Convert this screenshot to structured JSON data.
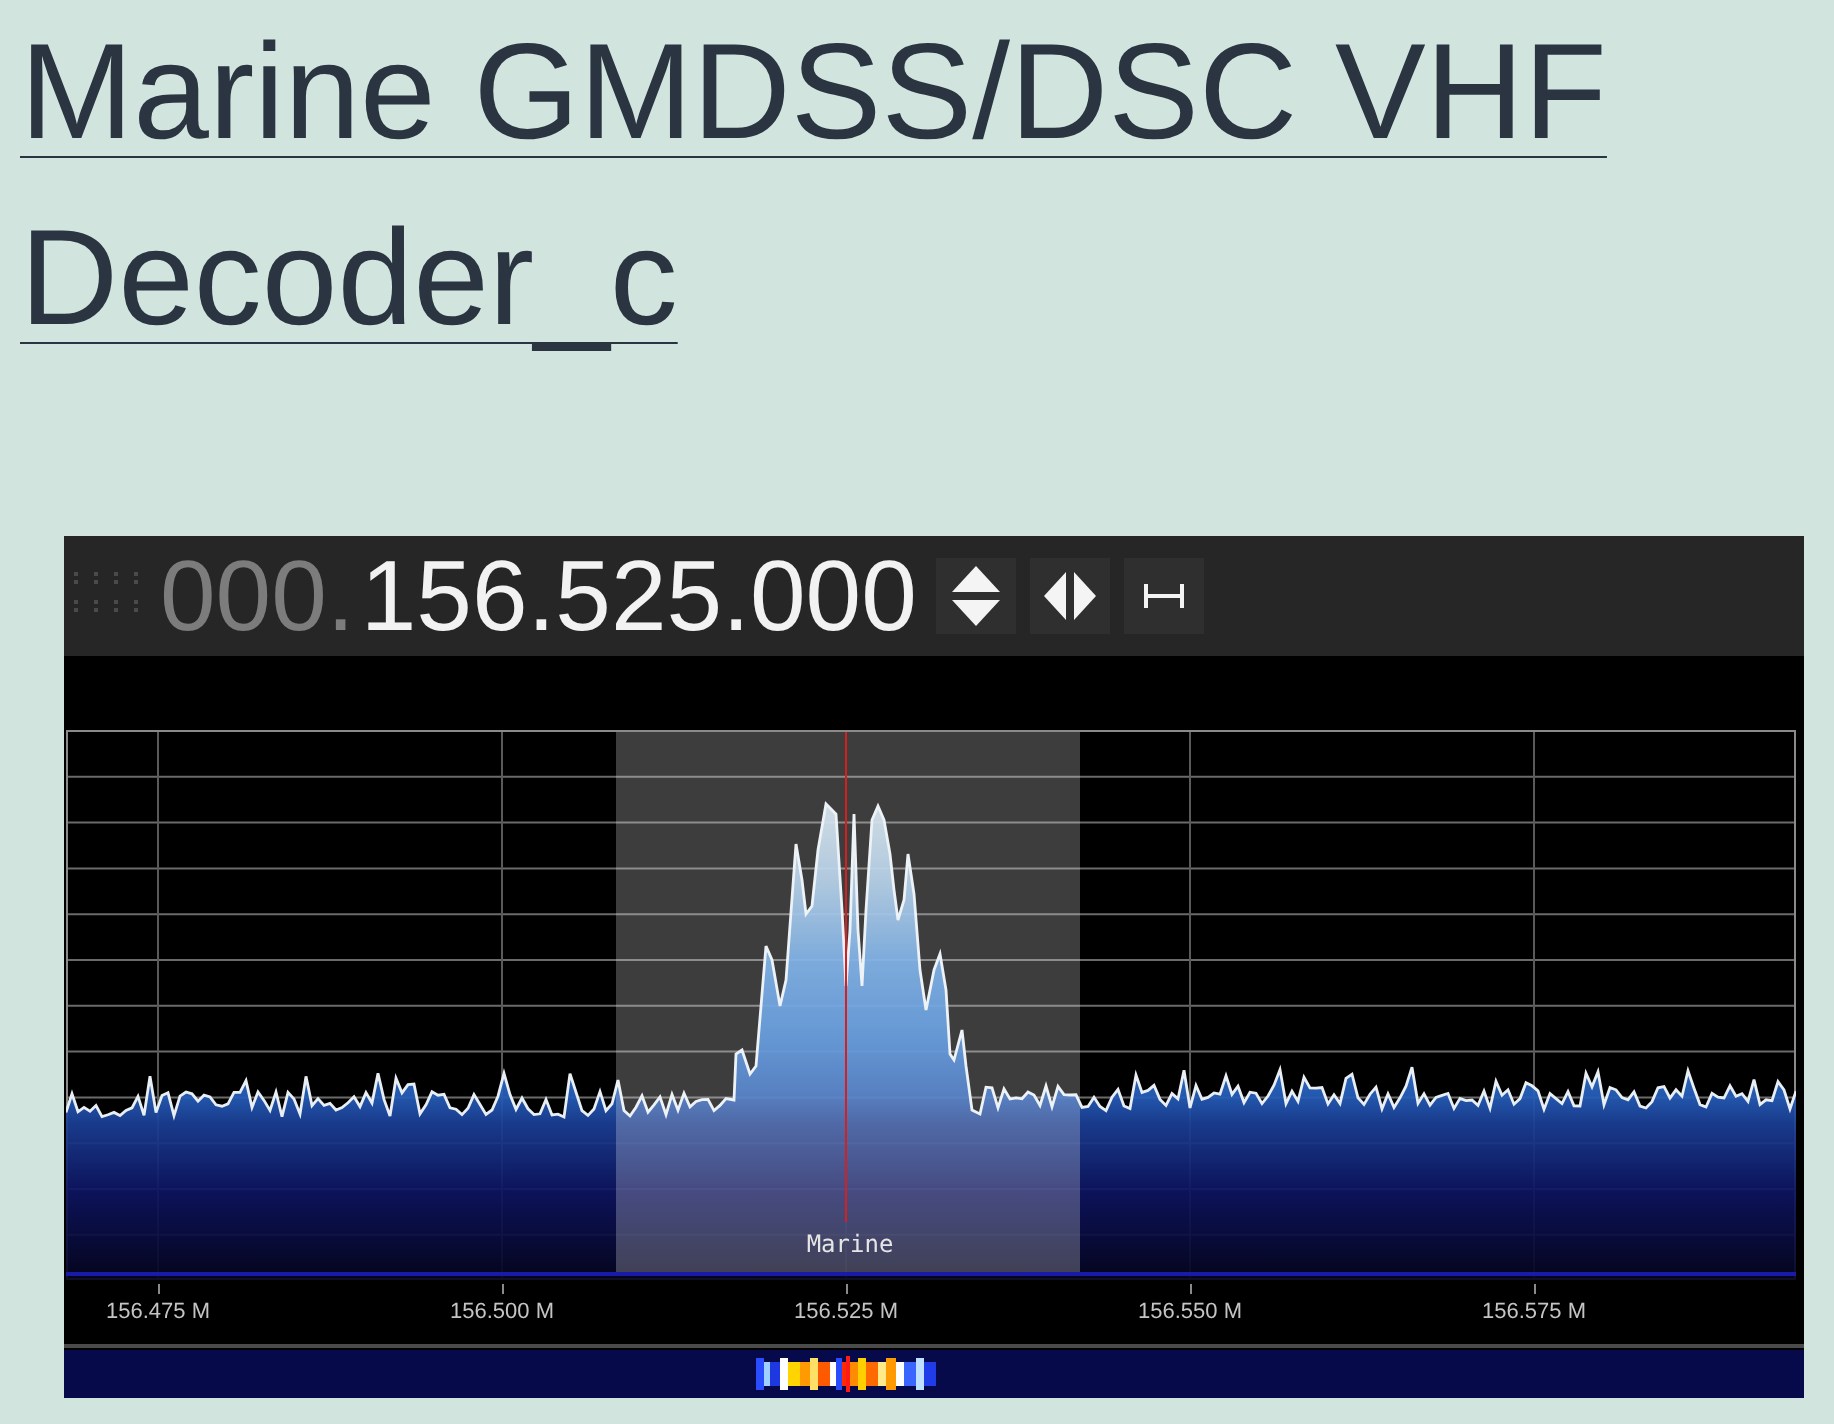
{
  "title": "Marine GMDSS/DSC VHF Decoder_c",
  "sdr_window": {
    "frequency": {
      "prefix": "000.",
      "value": "156.525.000"
    },
    "vfo": {
      "label": "Marine"
    },
    "axis_labels": [
      "156.475 M",
      "156.500 M",
      "156.525 M",
      "156.550 M",
      "156.575 M"
    ]
  }
}
